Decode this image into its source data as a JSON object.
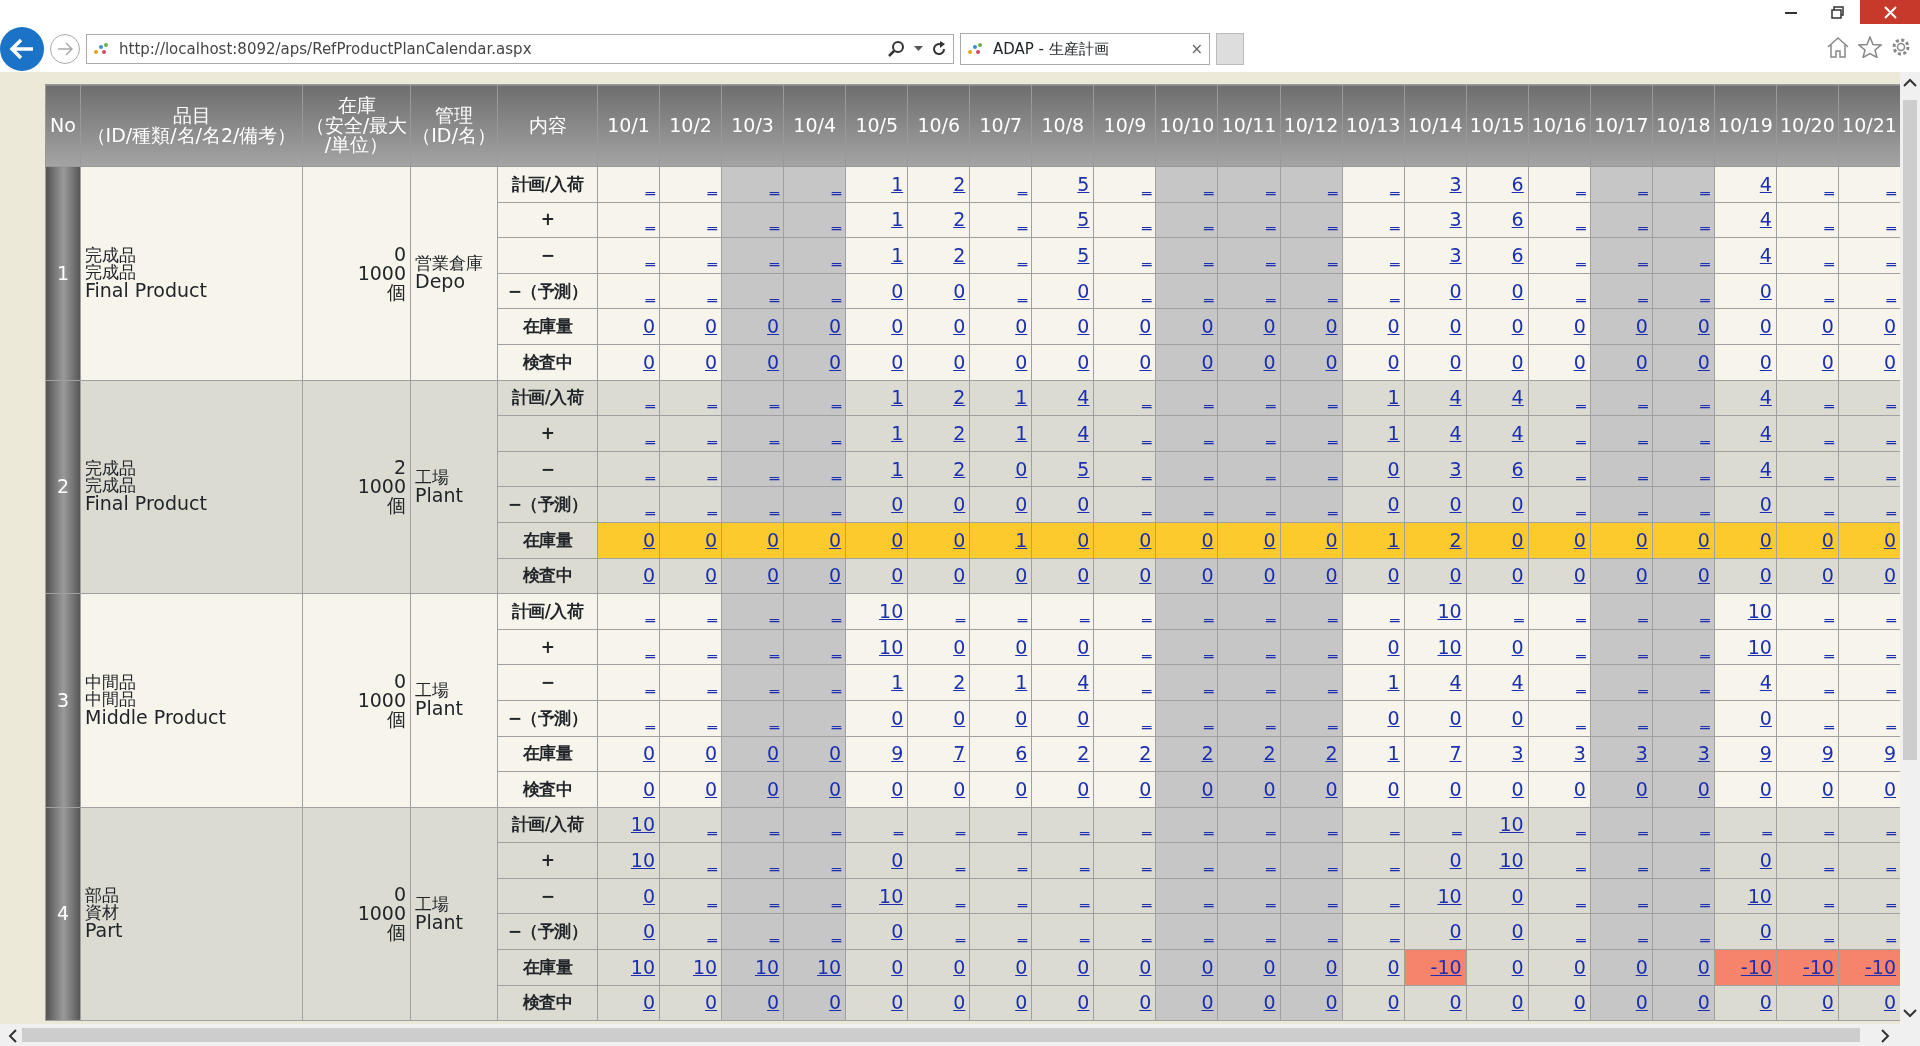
{
  "browser": {
    "url": "http://localhost:8092/aps/RefProductPlanCalendar.aspx",
    "tab_title": "ADAP - 生産計画",
    "tab_close": "×"
  },
  "table": {
    "headers": {
      "no": [
        "No"
      ],
      "item": [
        "品目",
        "（ID/種類/名/名2/備考）"
      ],
      "stock": [
        "在庫",
        "（安全/最大",
        "/単位）"
      ],
      "management": [
        "管理",
        "（ID/名）"
      ],
      "content": [
        "内容"
      ]
    },
    "dates": [
      {
        "label": "10/1",
        "holiday": false
      },
      {
        "label": "10/2",
        "holiday": false
      },
      {
        "label": "10/3",
        "holiday": true
      },
      {
        "label": "10/4",
        "holiday": true
      },
      {
        "label": "10/5",
        "holiday": false
      },
      {
        "label": "10/6",
        "holiday": false
      },
      {
        "label": "10/7",
        "holiday": false
      },
      {
        "label": "10/8",
        "holiday": false
      },
      {
        "label": "10/9",
        "holiday": false
      },
      {
        "label": "10/10",
        "holiday": true
      },
      {
        "label": "10/11",
        "holiday": true
      },
      {
        "label": "10/12",
        "holiday": true
      },
      {
        "label": "10/13",
        "holiday": false
      },
      {
        "label": "10/14",
        "holiday": false
      },
      {
        "label": "10/15",
        "holiday": false
      },
      {
        "label": "10/16",
        "holiday": false
      },
      {
        "label": "10/17",
        "holiday": true
      },
      {
        "label": "10/18",
        "holiday": true
      },
      {
        "label": "10/19",
        "holiday": false
      },
      {
        "label": "10/20",
        "holiday": false
      },
      {
        "label": "10/21",
        "holiday": false
      }
    ],
    "products": [
      {
        "no": "1",
        "item": [
          "完成品",
          "完成品",
          "Final Product"
        ],
        "stock": [
          "0",
          "1000",
          "個"
        ],
        "management": [
          "営業倉庫",
          "Depo"
        ],
        "rows": [
          {
            "label": "計画/入荷",
            "cells": [
              "_",
              "_",
              "_",
              "_",
              "1",
              "2",
              "_",
              "5",
              "_",
              "_",
              "_",
              "_",
              "_",
              "3",
              "6",
              "_",
              "_",
              "_",
              "4",
              "_",
              "_"
            ]
          },
          {
            "label": "+",
            "cells": [
              "_",
              "_",
              "_",
              "_",
              "1",
              "2",
              "_",
              "5",
              "_",
              "_",
              "_",
              "_",
              "_",
              "3",
              "6",
              "_",
              "_",
              "_",
              "4",
              "_",
              "_"
            ]
          },
          {
            "label": "−",
            "cells": [
              "_",
              "_",
              "_",
              "_",
              "1",
              "2",
              "_",
              "5",
              "_",
              "_",
              "_",
              "_",
              "_",
              "3",
              "6",
              "_",
              "_",
              "_",
              "4",
              "_",
              "_"
            ]
          },
          {
            "label": "−（予測）",
            "cells": [
              "_",
              "_",
              "_",
              "_",
              "0",
              "0",
              "_",
              "0",
              "_",
              "_",
              "_",
              "_",
              "_",
              "0",
              "0",
              "_",
              "_",
              "_",
              "0",
              "_",
              "_"
            ]
          },
          {
            "label": "在庫量",
            "warning": false,
            "cells": [
              "0",
              "0",
              "0",
              "0",
              "0",
              "0",
              "0",
              "0",
              "0",
              "0",
              "0",
              "0",
              "0",
              "0",
              "0",
              "0",
              "0",
              "0",
              "0",
              "0",
              "0"
            ]
          },
          {
            "label": "検査中",
            "cells": [
              "0",
              "0",
              "0",
              "0",
              "0",
              "0",
              "0",
              "0",
              "0",
              "0",
              "0",
              "0",
              "0",
              "0",
              "0",
              "0",
              "0",
              "0",
              "0",
              "0",
              "0"
            ]
          }
        ]
      },
      {
        "no": "2",
        "item": [
          "完成品",
          "完成品",
          "Final Product"
        ],
        "stock": [
          "2",
          "1000",
          "個"
        ],
        "management": [
          "工場",
          "Plant"
        ],
        "rows": [
          {
            "label": "計画/入荷",
            "cells": [
              "_",
              "_",
              "_",
              "_",
              "1",
              "2",
              "1",
              "4",
              "_",
              "_",
              "_",
              "_",
              "1",
              "4",
              "4",
              "_",
              "_",
              "_",
              "4",
              "_",
              "_"
            ]
          },
          {
            "label": "+",
            "cells": [
              "_",
              "_",
              "_",
              "_",
              "1",
              "2",
              "1",
              "4",
              "_",
              "_",
              "_",
              "_",
              "1",
              "4",
              "4",
              "_",
              "_",
              "_",
              "4",
              "_",
              "_"
            ]
          },
          {
            "label": "−",
            "cells": [
              "_",
              "_",
              "_",
              "_",
              "1",
              "2",
              "0",
              "5",
              "_",
              "_",
              "_",
              "_",
              "0",
              "3",
              "6",
              "_",
              "_",
              "_",
              "4",
              "_",
              "_"
            ]
          },
          {
            "label": "−（予測）",
            "cells": [
              "_",
              "_",
              "_",
              "_",
              "0",
              "0",
              "0",
              "0",
              "_",
              "_",
              "_",
              "_",
              "0",
              "0",
              "0",
              "_",
              "_",
              "_",
              "0",
              "_",
              "_"
            ]
          },
          {
            "label": "在庫量",
            "warning": true,
            "cells": [
              "0",
              "0",
              "0",
              "0",
              "0",
              "0",
              "1",
              "0",
              "0",
              "0",
              "0",
              "0",
              "1",
              "2",
              "0",
              "0",
              "0",
              "0",
              "0",
              "0",
              "0"
            ]
          },
          {
            "label": "検査中",
            "cells": [
              "0",
              "0",
              "0",
              "0",
              "0",
              "0",
              "0",
              "0",
              "0",
              "0",
              "0",
              "0",
              "0",
              "0",
              "0",
              "0",
              "0",
              "0",
              "0",
              "0",
              "0"
            ]
          }
        ]
      },
      {
        "no": "3",
        "item": [
          "中間品",
          "中間品",
          "Middle Product"
        ],
        "stock": [
          "0",
          "1000",
          "個"
        ],
        "management": [
          "工場",
          "Plant"
        ],
        "rows": [
          {
            "label": "計画/入荷",
            "cells": [
              "_",
              "_",
              "_",
              "_",
              "10",
              "_",
              "_",
              "_",
              "_",
              "_",
              "_",
              "_",
              "_",
              "10",
              "_",
              "_",
              "_",
              "_",
              "10",
              "_",
              "_"
            ]
          },
          {
            "label": "+",
            "cells": [
              "_",
              "_",
              "_",
              "_",
              "10",
              "0",
              "0",
              "0",
              "_",
              "_",
              "_",
              "_",
              "0",
              "10",
              "0",
              "_",
              "_",
              "_",
              "10",
              "_",
              "_"
            ]
          },
          {
            "label": "−",
            "cells": [
              "_",
              "_",
              "_",
              "_",
              "1",
              "2",
              "1",
              "4",
              "_",
              "_",
              "_",
              "_",
              "1",
              "4",
              "4",
              "_",
              "_",
              "_",
              "4",
              "_",
              "_"
            ]
          },
          {
            "label": "−（予測）",
            "cells": [
              "_",
              "_",
              "_",
              "_",
              "0",
              "0",
              "0",
              "0",
              "_",
              "_",
              "_",
              "_",
              "0",
              "0",
              "0",
              "_",
              "_",
              "_",
              "0",
              "_",
              "_"
            ]
          },
          {
            "label": "在庫量",
            "warning": false,
            "cells": [
              "0",
              "0",
              "0",
              "0",
              "9",
              "7",
              "6",
              "2",
              "2",
              "2",
              "2",
              "2",
              "1",
              "7",
              "3",
              "3",
              "3",
              "3",
              "9",
              "9",
              "9"
            ]
          },
          {
            "label": "検査中",
            "cells": [
              "0",
              "0",
              "0",
              "0",
              "0",
              "0",
              "0",
              "0",
              "0",
              "0",
              "0",
              "0",
              "0",
              "0",
              "0",
              "0",
              "0",
              "0",
              "0",
              "0",
              "0"
            ]
          }
        ]
      },
      {
        "no": "4",
        "item": [
          "部品",
          "資材",
          "Part"
        ],
        "stock": [
          "0",
          "1000",
          "個"
        ],
        "management": [
          "工場",
          "Plant"
        ],
        "rows": [
          {
            "label": "計画/入荷",
            "cells": [
              "10",
              "_",
              "_",
              "_",
              "_",
              "_",
              "_",
              "_",
              "_",
              "_",
              "_",
              "_",
              "_",
              "_",
              "10",
              "_",
              "_",
              "_",
              "_",
              "_",
              "_"
            ]
          },
          {
            "label": "+",
            "cells": [
              "10",
              "_",
              "_",
              "_",
              "0",
              "_",
              "_",
              "_",
              "_",
              "_",
              "_",
              "_",
              "_",
              "0",
              "10",
              "_",
              "_",
              "_",
              "0",
              "_",
              "_"
            ]
          },
          {
            "label": "−",
            "cells": [
              "0",
              "_",
              "_",
              "_",
              "10",
              "_",
              "_",
              "_",
              "_",
              "_",
              "_",
              "_",
              "_",
              "10",
              "0",
              "_",
              "_",
              "_",
              "10",
              "_",
              "_"
            ]
          },
          {
            "label": "−（予測）",
            "cells": [
              "0",
              "_",
              "_",
              "_",
              "0",
              "_",
              "_",
              "_",
              "_",
              "_",
              "_",
              "_",
              "_",
              "0",
              "0",
              "_",
              "_",
              "_",
              "0",
              "_",
              "_"
            ]
          },
          {
            "label": "在庫量",
            "warning": false,
            "shortage": [
              false,
              false,
              false,
              false,
              false,
              false,
              false,
              false,
              false,
              false,
              false,
              false,
              false,
              true,
              false,
              false,
              false,
              false,
              true,
              true,
              true
            ],
            "cells": [
              "10",
              "10",
              "10",
              "10",
              "0",
              "0",
              "0",
              "0",
              "0",
              "0",
              "0",
              "0",
              "0",
              "-10",
              "0",
              "0",
              "0",
              "0",
              "-10",
              "-10",
              "-10"
            ]
          },
          {
            "label": "検査中",
            "cells": [
              "0",
              "0",
              "0",
              "0",
              "0",
              "0",
              "0",
              "0",
              "0",
              "0",
              "0",
              "0",
              "0",
              "0",
              "0",
              "0",
              "0",
              "0",
              "0",
              "0",
              "0"
            ]
          }
        ]
      }
    ]
  }
}
